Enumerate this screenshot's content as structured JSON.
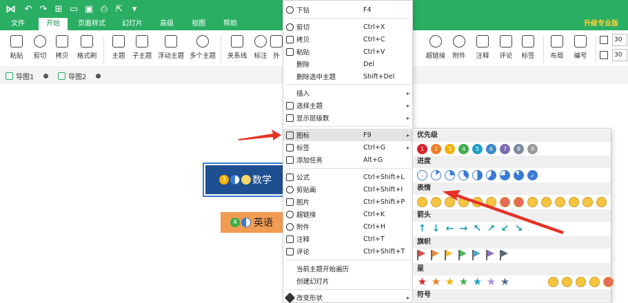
{
  "titlebar": {
    "quick_access_icons": [
      "undo-icon",
      "redo-icon",
      "new-icon",
      "open-icon",
      "save-icon",
      "print-icon",
      "export-icon",
      "customize-icon"
    ]
  },
  "menu": {
    "tabs": [
      "文件",
      "开始",
      "页面样式",
      "幻灯片",
      "高级",
      "视图",
      "帮助"
    ],
    "active": "开始",
    "upgrade": "升级专业版"
  },
  "ribbon": {
    "left_buttons": [
      "粘贴",
      "剪切",
      "拷贝",
      "格式刷",
      "主题",
      "子主题",
      "浮动主题",
      "多个主题",
      "关系线",
      "标注",
      "外"
    ],
    "right_buttons": [
      "超链接",
      "附件",
      "注释",
      "评论",
      "标签",
      "布局",
      "编号"
    ],
    "spin_values": [
      "30",
      "30"
    ]
  },
  "doc_tabs": [
    "导图1",
    "导图2"
  ],
  "canvas": {
    "topics": [
      {
        "num": "3",
        "text": "数学"
      },
      {
        "num": "4",
        "text": "英语"
      }
    ]
  },
  "context_menu": {
    "items": [
      {
        "label": "下钻",
        "shortcut": "F4",
        "icon": "drill-down-icon"
      },
      {
        "label": "剪切",
        "shortcut": "Ctrl+X",
        "icon": "cut-icon"
      },
      {
        "label": "拷贝",
        "shortcut": "Ctrl+C",
        "icon": "copy-icon"
      },
      {
        "label": "粘贴",
        "shortcut": "Ctrl+V",
        "icon": "paste-icon"
      },
      {
        "label": "删除",
        "shortcut": "Del",
        "icon": ""
      },
      {
        "label": "删除选中主题",
        "shortcut": "Shift+Del",
        "icon": ""
      },
      {
        "label": "插入",
        "shortcut": "",
        "icon": "",
        "submenu": true
      },
      {
        "label": "选择主题",
        "shortcut": "",
        "icon": "select-topic-icon",
        "submenu": true
      },
      {
        "label": "显示层级数",
        "shortcut": "",
        "icon": "layers-icon",
        "submenu": true
      },
      {
        "label": "图标",
        "shortcut": "F9",
        "icon": "icon-icon",
        "submenu": true,
        "highlighted": true
      },
      {
        "label": "标签",
        "shortcut": "Ctrl+G",
        "icon": "tag-icon",
        "submenu": true
      },
      {
        "label": "添加任务",
        "shortcut": "Alt+G",
        "icon": "task-icon"
      },
      {
        "label": "公式",
        "shortcut": "Ctrl+Shift+L",
        "icon": "formula-icon"
      },
      {
        "label": "剪贴画",
        "shortcut": "Ctrl+Shift+I",
        "icon": "clipart-icon"
      },
      {
        "label": "图片",
        "shortcut": "Ctrl+Shift+P",
        "icon": "image-icon"
      },
      {
        "label": "超链接",
        "shortcut": "Ctrl+K",
        "icon": "link-icon"
      },
      {
        "label": "附件",
        "shortcut": "Ctrl+H",
        "icon": "attachment-icon"
      },
      {
        "label": "注释",
        "shortcut": "Ctrl+T",
        "icon": "note-icon"
      },
      {
        "label": "评论",
        "shortcut": "Ctrl+Shift+T",
        "icon": "comment-icon"
      },
      {
        "label": "当前主题开始遍历",
        "shortcut": "",
        "icon": ""
      },
      {
        "label": "创建幻灯片",
        "shortcut": "",
        "icon": ""
      },
      {
        "label": "改变形状",
        "shortcut": "",
        "icon": "shape-icon",
        "submenu": true
      }
    ]
  },
  "icon_panel": {
    "sections": [
      "优先级",
      "进度",
      "表情",
      "箭头",
      "旗帜",
      "星",
      "符号"
    ],
    "priority": [
      "1",
      "2",
      "3",
      "4",
      "5",
      "6",
      "7",
      "8",
      "9"
    ],
    "priority_colors": [
      "#d9232a",
      "#ef7d22",
      "#f4b000",
      "#3fae49",
      "#21a1c4",
      "#3a87c8",
      "#7b68b0",
      "#7c8aa0",
      "#9a9a9a"
    ],
    "arrow_glyphs": [
      "↑",
      "↓",
      "←",
      "→",
      "↖",
      "↗",
      "↙",
      "↘"
    ],
    "flag_colors": [
      "#e24a4a",
      "#f08a3c",
      "#f2c23b",
      "#4fb35a",
      "#4aa6c8",
      "#8a6fc2",
      "#556677"
    ],
    "star_colors": [
      "#d9232a",
      "#ef7d22",
      "#f4b000",
      "#3fae49",
      "#21a1c4",
      "#a492d8",
      "#4f6a8a"
    ]
  }
}
